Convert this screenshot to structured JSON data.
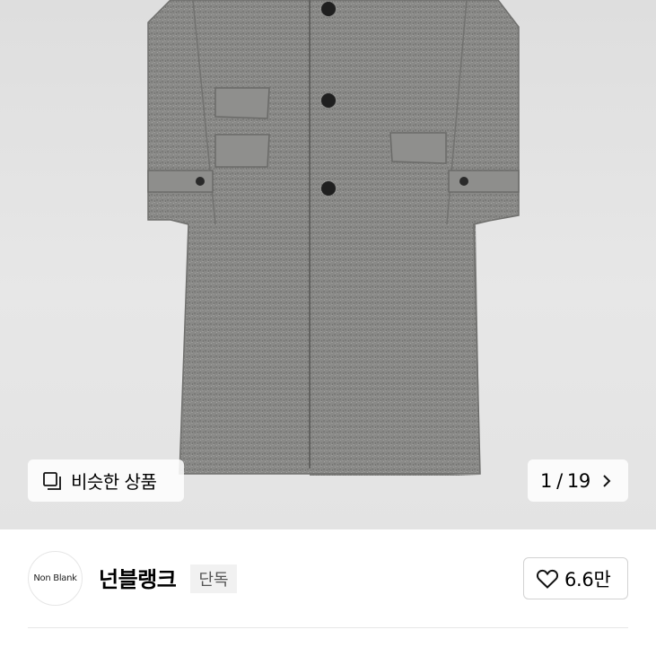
{
  "gallery": {
    "similar_products_label": "비슷한 상품",
    "current_index": "1",
    "separator": "/",
    "total": "19"
  },
  "brand": {
    "logo_text": "Non Blank",
    "name": "넌블랭크",
    "badge": "단독"
  },
  "like": {
    "count": "6.6만"
  },
  "icons": {
    "similar": "copy-squares-icon",
    "next": "chevron-right-icon",
    "like": "heart-outline-icon"
  },
  "colors": {
    "coat": "#8a8a88",
    "button_dark": "#1f1f1f"
  }
}
